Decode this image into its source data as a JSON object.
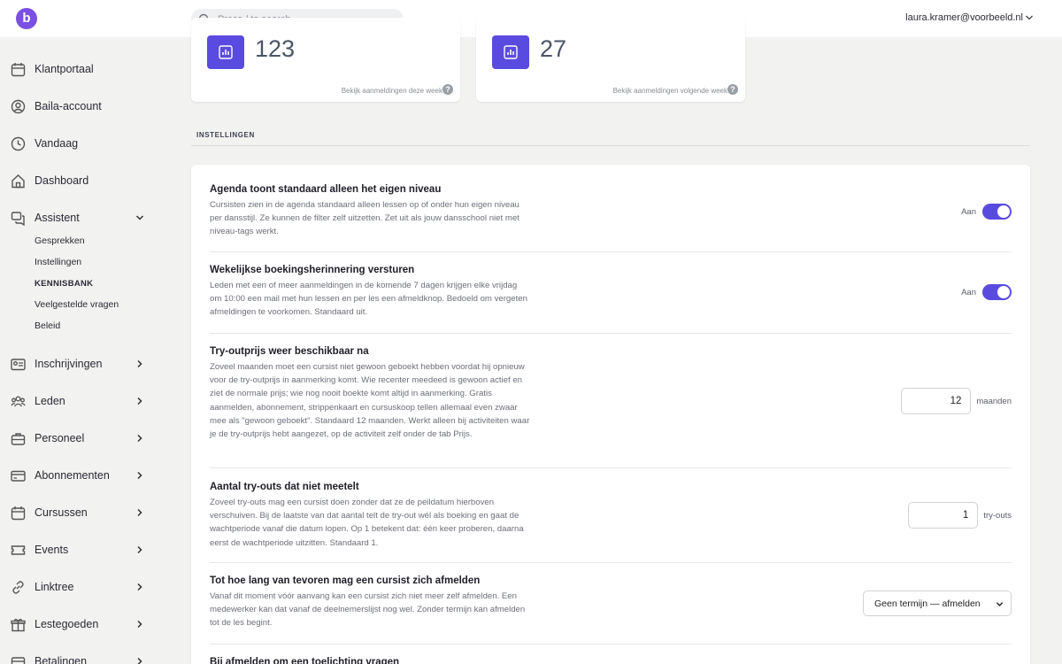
{
  "header": {
    "logo": "b",
    "search_placeholder": "Press / to search",
    "user_email": "laura.kramer@voorbeeld.nl"
  },
  "sidebar": {
    "items": [
      {
        "label": "Klantportaal",
        "icon": "calendar-icon"
      },
      {
        "label": "Baila-account",
        "icon": "user-circle-icon"
      },
      {
        "label": "Vandaag",
        "icon": "clock-icon"
      },
      {
        "label": "Dashboard",
        "icon": "home-icon"
      },
      {
        "label": "Assistent",
        "icon": "chat-icon"
      },
      {
        "label": "Inschrijvingen",
        "icon": "id-card-icon"
      },
      {
        "label": "Leden",
        "icon": "users-icon"
      },
      {
        "label": "Personeel",
        "icon": "briefcase-icon"
      },
      {
        "label": "Abonnementen",
        "icon": "card-icon"
      },
      {
        "label": "Cursussen",
        "icon": "calendar-icon"
      },
      {
        "label": "Events",
        "icon": "ticket-icon"
      },
      {
        "label": "Linktree",
        "icon": "link-icon"
      },
      {
        "label": "Lestegoeden",
        "icon": "gift-icon"
      },
      {
        "label": "Betalingen",
        "icon": "wallet-icon"
      }
    ],
    "assistent_sub": [
      "Gesprekken",
      "Instellingen",
      "KENNISBANK",
      "Veelgestelde vragen",
      "Beleid"
    ]
  },
  "stats": [
    {
      "value": "123",
      "link": "Bekijk aanmeldingen deze week"
    },
    {
      "value": "27",
      "link": "Bekijk aanmeldingen volgende week"
    }
  ],
  "section_title": "INSTELLINGEN",
  "settings": [
    {
      "title": "Agenda toont standaard alleen het eigen niveau",
      "desc": "Cursisten zien in de agenda standaard alleen lessen op of onder hun eigen niveau per dansstijl. Ze kunnen de filter zelf uitzetten. Zet uit als jouw dansschool niet met niveau-tags werkt.",
      "control_label": "Aan"
    },
    {
      "title": "Wekelijkse boekingsherinnering versturen",
      "desc": "Leden met een of meer aanmeldingen in de komende 7 dagen krijgen elke vrijdag om 10:00 een mail met hun lessen en per les een afmeldknop. Bedoeld om vergeten afmeldingen te voorkomen. Standaard uit.",
      "control_label": "Aan"
    },
    {
      "title": "Try-outprijs weer beschikbaar na",
      "desc": "Zoveel maanden moet een cursist niet gewoon geboekt hebben voordat hij opnieuw voor de try-outprijs in aanmerking komt. Wie recenter meedeed is gewoon actief en ziet de normale prijs; wie nog nooit boekte komt altijd in aanmerking. Gratis aanmelden, abonnement, strippenkaart en cursuskoop tellen allemaal even zwaar mee als \"gewoon geboekt\". Standaard 12 maanden. Werkt alleen bij activiteiten waar je de try-outprijs hebt aangezet, op de activiteit zelf onder de tab Prijs.",
      "value": "12",
      "unit": "maanden"
    },
    {
      "title": "Aantal try-outs dat niet meetelt",
      "desc": "Zoveel try-outs mag een cursist doen zonder dat ze de peildatum hierboven verschuiven. Bij de laatste van dat aantal telt de try-out wél als boeking en gaat de wachtperiode vanaf die datum lopen. Op 1 betekent dat: één keer proberen, daarna eerst de wachtperiode uitzitten. Standaard 1.",
      "value": "1",
      "unit": "try-outs"
    },
    {
      "title": "Tot hoe lang van tevoren mag een cursist zich afmelden",
      "desc": "Vanaf dit moment vóór aanvang kan een cursist zich niet meer zelf afmelden. Een medewerker kan dat vanaf de deelnemerslijst nog wel. Zonder termijn kan afmelden tot de les begint.",
      "selected": "Geen termijn — afmelden"
    },
    {
      "title": "Bij afmelden om een toelichting vragen"
    }
  ],
  "colors": {
    "accent": "#5a4be0",
    "brand": "#7b4fe3"
  }
}
